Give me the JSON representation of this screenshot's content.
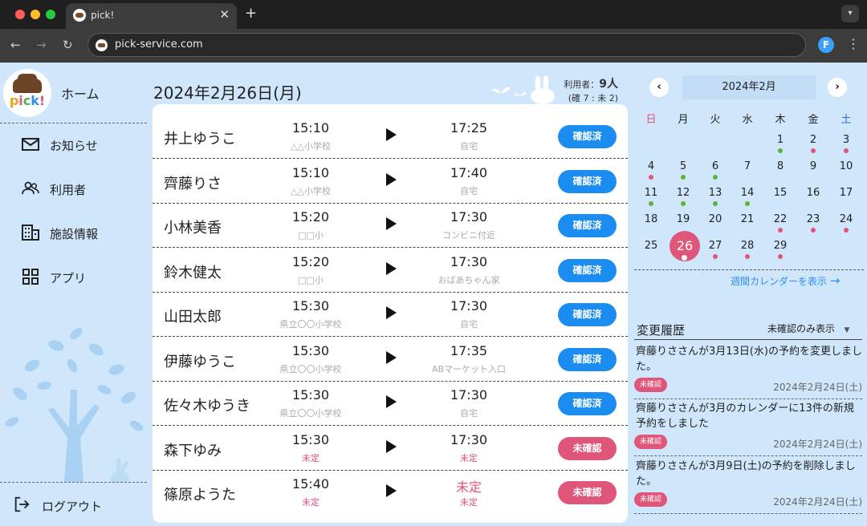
{
  "browser": {
    "tab_title": "pick!",
    "tab_close": "✕",
    "new_tab": "+",
    "url": "pick-service.com",
    "profile_letter": "F"
  },
  "sidebar": {
    "logo_text": "pick!",
    "home_label": "ホーム",
    "items": [
      {
        "label": "お知らせ",
        "icon": "mail-icon"
      },
      {
        "label": "利用者",
        "icon": "users-icon"
      },
      {
        "label": "施設情報",
        "icon": "building-icon"
      },
      {
        "label": "アプリ",
        "icon": "apps-icon"
      }
    ],
    "logout_label": "ログアウト"
  },
  "main": {
    "date_heading": "2024年2月26日(月)",
    "users_label": "利用者：",
    "users_count": "9人",
    "users_sub": "(確 7 : 未 2)",
    "rows": [
      {
        "name": "井上ゆうこ",
        "pickup_time": "15:10",
        "pickup_place": "△△小学校",
        "drop_time": "17:25",
        "drop_place": "自宅",
        "status": "確認済"
      },
      {
        "name": "齊藤りさ",
        "pickup_time": "15:10",
        "pickup_place": "△△小学校",
        "drop_time": "17:40",
        "drop_place": "自宅",
        "status": "確認済"
      },
      {
        "name": "小林美香",
        "pickup_time": "15:20",
        "pickup_place": "□□小",
        "drop_time": "17:30",
        "drop_place": "コンビニ付近",
        "status": "確認済"
      },
      {
        "name": "鈴木健太",
        "pickup_time": "15:20",
        "pickup_place": "□□小",
        "drop_time": "17:30",
        "drop_place": "おばあちゃん家",
        "status": "確認済"
      },
      {
        "name": "山田太郎",
        "pickup_time": "15:30",
        "pickup_place": "県立〇〇小学校",
        "drop_time": "17:30",
        "drop_place": "自宅",
        "status": "確認済"
      },
      {
        "name": "伊藤ゆうこ",
        "pickup_time": "15:30",
        "pickup_place": "県立〇〇小学校",
        "drop_time": "17:35",
        "drop_place": "ABマーケット入口",
        "status": "確認済"
      },
      {
        "name": "佐々木ゆうき",
        "pickup_time": "15:30",
        "pickup_place": "県立〇〇小学校",
        "drop_time": "17:30",
        "drop_place": "自宅",
        "status": "確認済"
      },
      {
        "name": "森下ゆみ",
        "pickup_time": "15:30",
        "pickup_place": "未定",
        "drop_time": "17:30",
        "drop_place": "未定",
        "status": "未確認"
      },
      {
        "name": "篠原ようた",
        "pickup_time": "15:40",
        "pickup_place": "未定",
        "drop_time": "未定",
        "drop_place": "未定",
        "status": "未確認"
      }
    ]
  },
  "calendar": {
    "title": "2024年2月",
    "prev": "‹",
    "next": "›",
    "weekdays": [
      "日",
      "月",
      "火",
      "水",
      "木",
      "金",
      "土"
    ],
    "first_weekday": 4,
    "days_in_month": 29,
    "today": 26,
    "dots": {
      "1": "green",
      "2": "pink",
      "3": "pink",
      "4": "pink",
      "5": "green",
      "6": "green",
      "11": "green",
      "12": "green",
      "13": "green",
      "14": "green",
      "22": "pink",
      "23": "pink",
      "24": "pink",
      "26": "white",
      "27": "pink",
      "28": "pink",
      "29": "pink"
    },
    "week_link": "週間カレンダーを表示",
    "week_link_arrow": "→"
  },
  "history": {
    "title": "変更履歴",
    "filter_label": "未確認のみ表示",
    "filter_caret": "▼",
    "items": [
      {
        "text": "齊藤りささんが3月13日(水)の予約を変更しました。",
        "badge": "未確認",
        "date": "2024年2月24日(土)"
      },
      {
        "text": "齊藤りささんが3月のカレンダーに13件の新規予約をしました",
        "badge": "未確認",
        "date": "2024年2月24日(土)"
      },
      {
        "text": "齊藤りささんが3月9日(土)の予約を削除しました。",
        "badge": "未確認",
        "date": "2024年2月24日(土)"
      }
    ]
  },
  "colors": {
    "accent_blue": "#1b8cf0",
    "accent_pink": "#e0557a",
    "dot_green": "#5cb531",
    "background": "#cfe6fb"
  }
}
